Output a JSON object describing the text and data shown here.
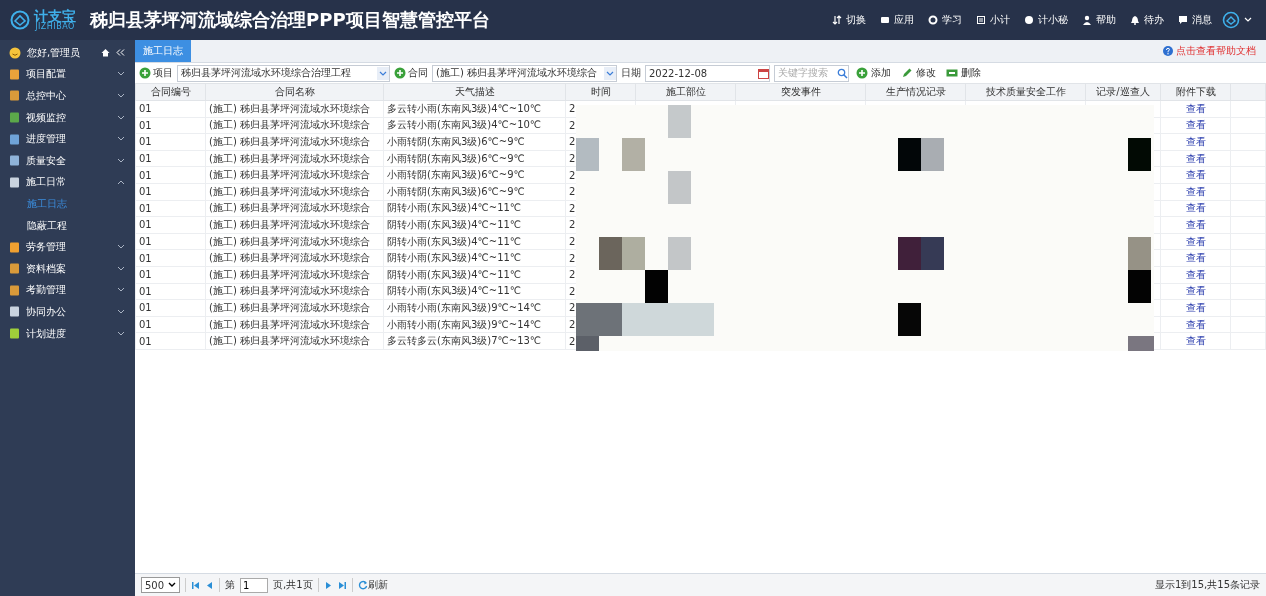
{
  "header": {
    "logo_name": "计支宝",
    "logo_sub": "JIZHIBAO",
    "title": "秭归县茅坪河流域综合治理PPP项目智慧管控平台",
    "menu": [
      {
        "label": "切换"
      },
      {
        "label": "应用"
      },
      {
        "label": "学习"
      },
      {
        "label": "小计"
      },
      {
        "label": "计小秘"
      },
      {
        "label": "帮助"
      },
      {
        "label": "待办"
      },
      {
        "label": "消息"
      }
    ]
  },
  "sidebar": {
    "greeting": "您好,管理员",
    "items": [
      {
        "label": "项目配置",
        "expanded": false
      },
      {
        "label": "总控中心",
        "expanded": false
      },
      {
        "label": "视频监控",
        "expanded": false
      },
      {
        "label": "进度管理",
        "expanded": false
      },
      {
        "label": "质量安全",
        "expanded": false
      },
      {
        "label": "施工日常",
        "expanded": true,
        "children": [
          {
            "label": "施工日志",
            "selected": true
          },
          {
            "label": "隐蔽工程",
            "selected": false
          }
        ]
      },
      {
        "label": "劳务管理",
        "expanded": false
      },
      {
        "label": "资料档案",
        "expanded": false
      },
      {
        "label": "考勤管理",
        "expanded": false
      },
      {
        "label": "协同办公",
        "expanded": false
      },
      {
        "label": "计划进度",
        "expanded": false
      }
    ]
  },
  "tabs": [
    {
      "label": "施工日志",
      "selected": true
    }
  ],
  "help_link": "点击查看帮助文档",
  "toolbar": {
    "project_label": "项目",
    "project_value": "秭归县茅坪河流域水环境综合治理工程",
    "contract_label": "合同",
    "contract_value": "(施工) 秭归县茅坪河流域水环境综合",
    "date_label": "日期",
    "date_value": "2022-12-08",
    "search_placeholder": "关键字搜索",
    "buttons": [
      "添加",
      "修改",
      "删除"
    ]
  },
  "table": {
    "columns": [
      "合同编号",
      "合同名称",
      "天气描述",
      "时间",
      "施工部位",
      "突发事件",
      "生产情况记录",
      "技术质量安全工作",
      "记录/巡查人",
      "附件下载"
    ],
    "rows": [
      {
        "contract_no": "01",
        "contract_name": "(施工) 秭归县茅坪河流域水环境综合",
        "weather": "多云转小雨(东南风3级)4℃~10℃",
        "time": "2",
        "attachment": "查看"
      },
      {
        "contract_no": "01",
        "contract_name": "(施工) 秭归县茅坪河流域水环境综合",
        "weather": "多云转小雨(东南风3级)4℃~10℃",
        "time": "2",
        "attachment": "查看"
      },
      {
        "contract_no": "01",
        "contract_name": "(施工) 秭归县茅坪河流域水环境综合",
        "weather": "小雨转阴(东南风3级)6℃~9℃",
        "time": "2",
        "attachment": "查看"
      },
      {
        "contract_no": "01",
        "contract_name": "(施工) 秭归县茅坪河流域水环境综合",
        "weather": "小雨转阴(东南风3级)6℃~9℃",
        "time": "2",
        "attachment": "查看"
      },
      {
        "contract_no": "01",
        "contract_name": "(施工) 秭归县茅坪河流域水环境综合",
        "weather": "小雨转阴(东南风3级)6℃~9℃",
        "time": "2",
        "attachment": "查看"
      },
      {
        "contract_no": "01",
        "contract_name": "(施工) 秭归县茅坪河流域水环境综合",
        "weather": "小雨转阴(东南风3级)6℃~9℃",
        "time": "2",
        "attachment": "查看"
      },
      {
        "contract_no": "01",
        "contract_name": "(施工) 秭归县茅坪河流域水环境综合",
        "weather": "阴转小雨(东风3级)4℃~11℃",
        "time": "2",
        "attachment": "查看"
      },
      {
        "contract_no": "01",
        "contract_name": "(施工) 秭归县茅坪河流域水环境综合",
        "weather": "阴转小雨(东风3级)4℃~11℃",
        "time": "2",
        "attachment": "查看"
      },
      {
        "contract_no": "01",
        "contract_name": "(施工) 秭归县茅坪河流域水环境综合",
        "weather": "阴转小雨(东风3级)4℃~11℃",
        "time": "2",
        "attachment": "查看"
      },
      {
        "contract_no": "01",
        "contract_name": "(施工) 秭归县茅坪河流域水环境综合",
        "weather": "阴转小雨(东风3级)4℃~11℃",
        "time": "2",
        "attachment": "查看"
      },
      {
        "contract_no": "01",
        "contract_name": "(施工) 秭归县茅坪河流域水环境综合",
        "weather": "阴转小雨(东风3级)4℃~11℃",
        "time": "2",
        "attachment": "查看"
      },
      {
        "contract_no": "01",
        "contract_name": "(施工) 秭归县茅坪河流域水环境综合",
        "weather": "阴转小雨(东风3级)4℃~11℃",
        "time": "2",
        "attachment": "查看"
      },
      {
        "contract_no": "01",
        "contract_name": "(施工) 秭归县茅坪河流域水环境综合",
        "weather": "小雨转小雨(东南风3级)9℃~14℃",
        "time": "2",
        "attachment": "查看"
      },
      {
        "contract_no": "01",
        "contract_name": "(施工) 秭归县茅坪河流域水环境综合",
        "weather": "小雨转小雨(东南风3级)9℃~14℃",
        "time": "2",
        "attachment": "查看"
      },
      {
        "contract_no": "01",
        "contract_name": "(施工) 秭归县茅坪河流域水环境综合",
        "weather": "多云转多云(东南风3级)7℃~13℃",
        "time": "2",
        "attachment": "查看"
      }
    ]
  },
  "pager": {
    "page_size": "500",
    "page_prefix": "第",
    "page": "1",
    "page_suffix": "页,共1页",
    "refresh": "刷新",
    "summary": "显示1到15,共15条记录"
  }
}
